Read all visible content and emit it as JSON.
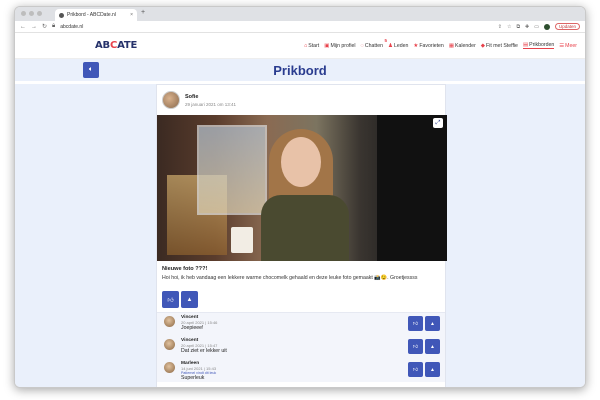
{
  "browser": {
    "tab_title": "Prikbord - ABCDate.nl",
    "tab_close": "×",
    "new_tab": "+",
    "url": "abcdate.nl",
    "update_label": "Updaten",
    "profile_initial": "T"
  },
  "site": {
    "logo_pre": "AB",
    "logo_mid": "C",
    "logo_post": "ATE",
    "nav": [
      {
        "label": "Start",
        "icon": "home-icon"
      },
      {
        "label": "Mijn profiel",
        "icon": "profile-icon"
      },
      {
        "label": "Chatten",
        "icon": "chat-icon",
        "badge": "5"
      },
      {
        "label": "Leden",
        "icon": "members-icon"
      },
      {
        "label": "Favorieten",
        "icon": "star-icon"
      },
      {
        "label": "Kalender",
        "icon": "calendar-icon"
      },
      {
        "label": "Fit met Steffie",
        "icon": "fitness-icon"
      },
      {
        "label": "Prikborden",
        "icon": "board-icon",
        "active": true
      },
      {
        "label": "Meer",
        "icon": "more-icon"
      }
    ]
  },
  "page": {
    "title": "Prikbord"
  },
  "post": {
    "author": "Sofie",
    "date": "29 januari 2021 om 13:41",
    "title": "Nieuwe foto ???!",
    "text": "Hoi hoi, ik heb vandaag een lekkere warme chocomelk gehaald en deze leuke foto gemaakt 📸😉. Groetjessss"
  },
  "comments": [
    {
      "name": "Vincent",
      "date": "20 april 2021 | 15:46",
      "text": "Joepieee!"
    },
    {
      "name": "Vincent",
      "date": "20 april 2021 | 15:47",
      "text": "Dat ziet er lekker uit"
    },
    {
      "name": "Marleen",
      "date": "14 juni 2021 | 15:43",
      "note": "Patiernel vindt dit leuk",
      "text": "Superleuk"
    }
  ],
  "colors": {
    "accent": "#4057b8",
    "brand_red": "#e8424b",
    "brand_navy": "#26326b",
    "page_bg": "#eaf0fb"
  }
}
